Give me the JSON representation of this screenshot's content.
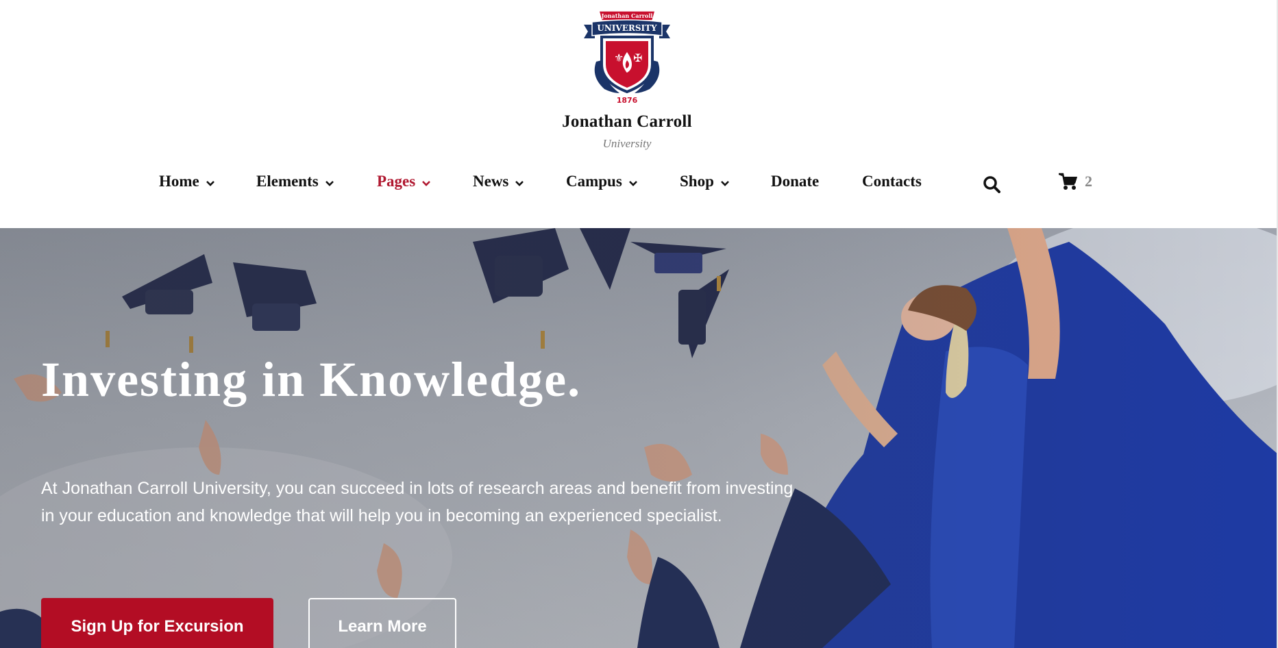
{
  "brand": {
    "logo_ribbon_top": "Jonathan Carroll",
    "logo_banner": "UNIVERSITY",
    "logo_year": "1876",
    "name": "Jonathan Carroll",
    "subtitle": "University"
  },
  "nav": {
    "items": [
      {
        "label": "Home",
        "has_dropdown": true,
        "active": false
      },
      {
        "label": "Elements",
        "has_dropdown": true,
        "active": false
      },
      {
        "label": "Pages",
        "has_dropdown": true,
        "active": true
      },
      {
        "label": "News",
        "has_dropdown": true,
        "active": false
      },
      {
        "label": "Campus",
        "has_dropdown": true,
        "active": false
      },
      {
        "label": "Shop",
        "has_dropdown": true,
        "active": false
      },
      {
        "label": "Donate",
        "has_dropdown": false,
        "active": false
      },
      {
        "label": "Contacts",
        "has_dropdown": false,
        "active": false
      }
    ],
    "search_icon": "search-icon",
    "cart_icon": "cart-icon",
    "cart_count": "2"
  },
  "hero": {
    "title": "Investing in Knowledge.",
    "text": "At Jonathan Carroll University, you can succeed in lots of research areas and benefit from investing in your education and knowledge that will help you in becoming an experienced specialist.",
    "primary_button": "Sign Up for Excursion",
    "secondary_button": "Learn More"
  },
  "colors": {
    "accent": "#b30d24",
    "active_nav": "#b01830",
    "navy": "#1b3468",
    "text": "#111111"
  }
}
